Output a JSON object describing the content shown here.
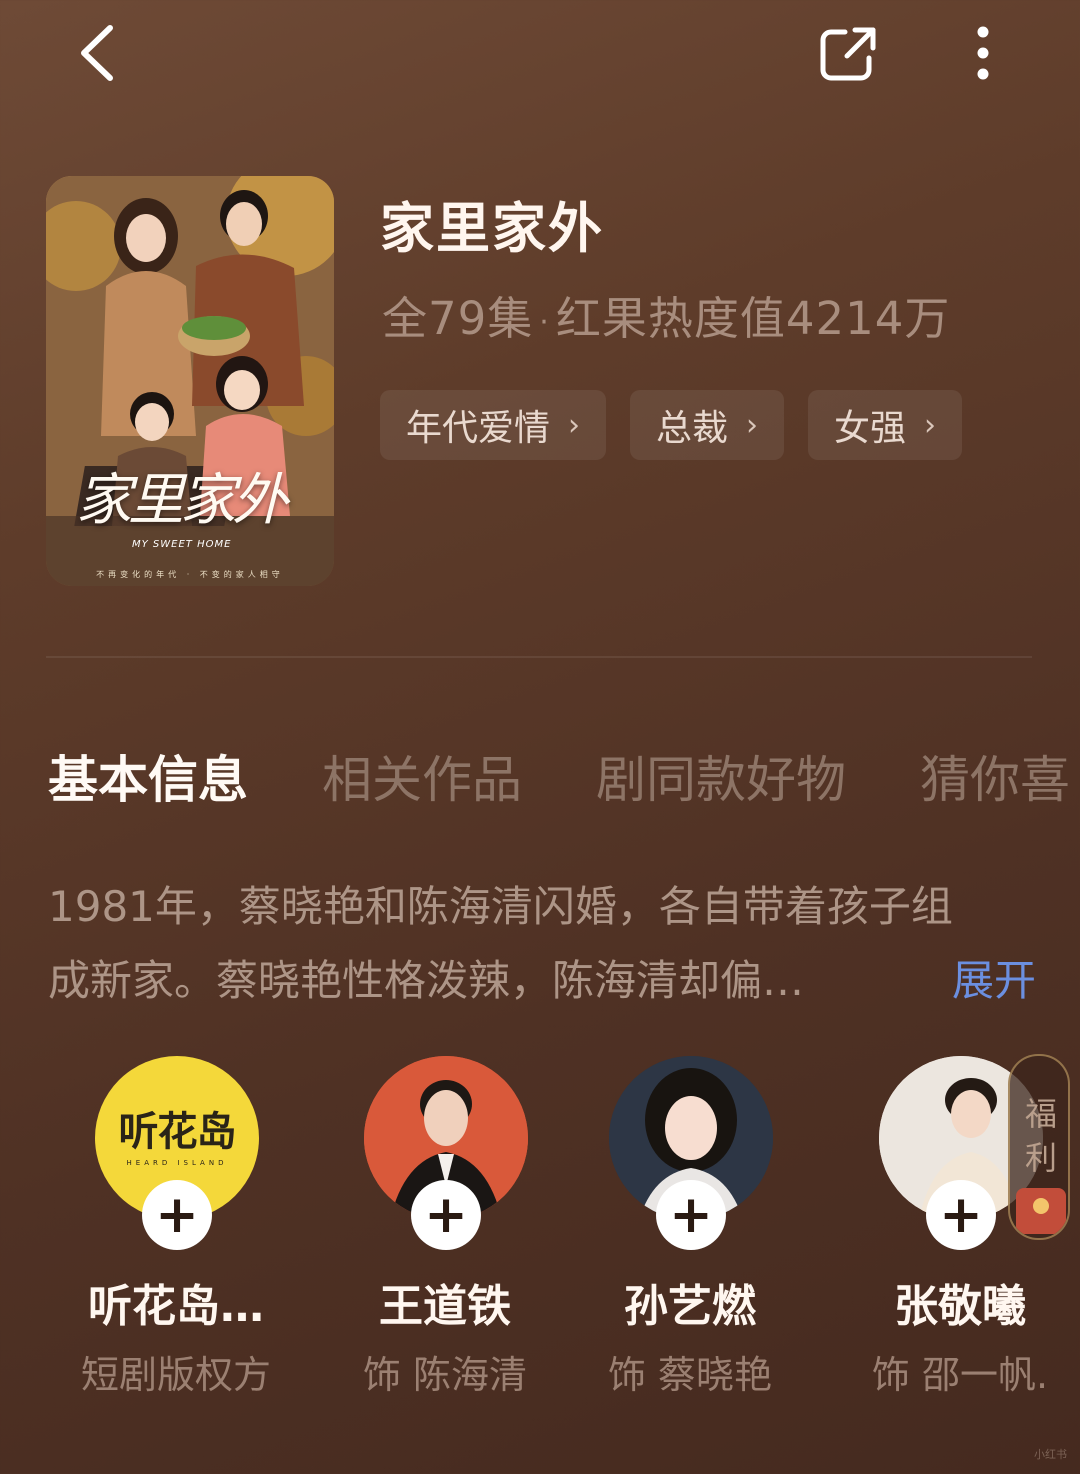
{
  "nav": {
    "back_icon": "chevron-left-icon",
    "share_icon": "share-icon",
    "more_icon": "more-vertical-icon"
  },
  "poster": {
    "logo": "家里家外",
    "subtitle": "MY SWEET HOME",
    "tagline": "不再变化的年代 · 不变的家人相守"
  },
  "show": {
    "title": "家里家外",
    "episodes": "全79集",
    "heat": "红果热度值4214万"
  },
  "tags": [
    {
      "label": "年代爱情"
    },
    {
      "label": "总裁"
    },
    {
      "label": "女强"
    }
  ],
  "tabs": [
    {
      "label": "基本信息",
      "active": true
    },
    {
      "label": "相关作品"
    },
    {
      "label": "剧同款好物"
    },
    {
      "label": "猜你喜"
    }
  ],
  "synopsis": {
    "line1": "1981年，蔡晓艳和陈海清闪婚，各自带着孩子组",
    "line2": "成新家。蔡晓艳性格泼辣，陈海清却偏…",
    "expand": "展开"
  },
  "cast": [
    {
      "name": "听花岛…",
      "role": "短剧版权方",
      "avatar_text": "听花岛",
      "avatar_sub": "HEARD ISLAND",
      "avatar_color": "#f4d83a"
    },
    {
      "name": "王道铁",
      "role": "饰 陈海清",
      "avatar_color": "#d9593a"
    },
    {
      "name": "孙艺燃",
      "role": "饰 蔡晓艳",
      "avatar_color": "#2d3645"
    },
    {
      "name": "张敬曦",
      "role": "饰 邵一帆.",
      "avatar_color": "#ece6df"
    }
  ],
  "welfare": {
    "label": "福利"
  },
  "watermark": "小红书",
  "colors": {
    "background": "#5a3a29",
    "accent_link": "#6b8fe0",
    "title": "#fff6ef",
    "muted": "#a88d7e"
  }
}
